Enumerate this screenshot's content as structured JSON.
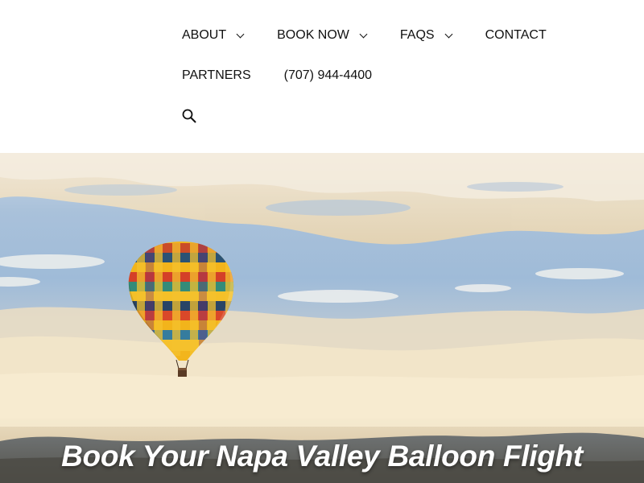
{
  "nav": {
    "row1": [
      {
        "label": "ABOUT",
        "dropdown": true
      },
      {
        "label": "BOOK NOW",
        "dropdown": true
      },
      {
        "label": "FAQS",
        "dropdown": true
      },
      {
        "label": "CONTACT",
        "dropdown": false
      }
    ],
    "row2": [
      {
        "label": "PARTNERS",
        "dropdown": false
      },
      {
        "label": "(707) 944-4400",
        "dropdown": false
      }
    ],
    "search_icon": "search-icon"
  },
  "hero": {
    "title": "Book Your Napa Valley Balloon Flight",
    "image": "hot-air-balloon-over-napa-valley"
  },
  "colors": {
    "header_bg": "#ffffff",
    "nav_text": "#111111",
    "hero_title": "#ffffff"
  }
}
